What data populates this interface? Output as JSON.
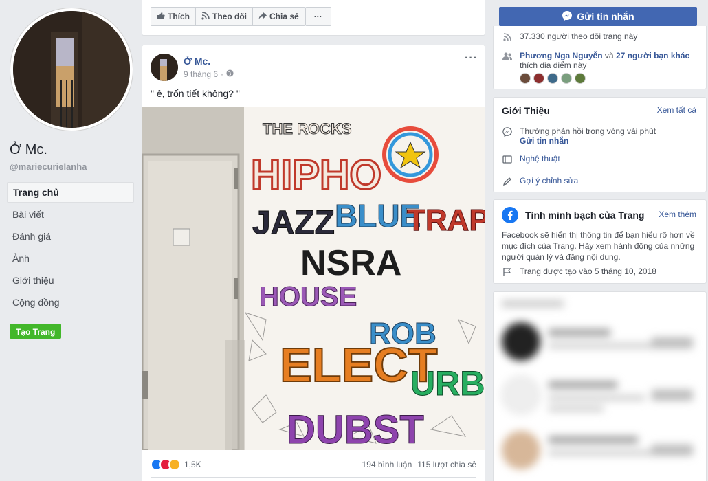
{
  "page": {
    "name": "Ở Mc.",
    "handle": "@mariecurielanha"
  },
  "nav": {
    "items": [
      {
        "label": "Trang chủ"
      },
      {
        "label": "Bài viết"
      },
      {
        "label": "Đánh giá"
      },
      {
        "label": "Ảnh"
      },
      {
        "label": "Giới thiệu"
      },
      {
        "label": "Cộng đồng"
      }
    ],
    "create_label": "Tạo Trang"
  },
  "actions": {
    "like_label": "Thích",
    "follow_label": "Theo dõi",
    "share_label": "Chia sẻ",
    "more_label": "···"
  },
  "post": {
    "author": "Ở Mc.",
    "date": "9 tháng 6",
    "separator": "·",
    "text": "\" ê, trốn tiết không? \"",
    "menu": "···",
    "reactions_count": "1,5K",
    "comments": "194 bình luận",
    "shares": "115 lượt chia sẻ"
  },
  "sidebar": {
    "message_button": "Gửi tin nhắn",
    "followers_text": "37.330 người theo dõi trang này",
    "friend_like": {
      "friend_name": "Phương Nga Nguyễn",
      "conjunction": "và",
      "others": "27 người bạn khác",
      "suffix": "thích địa điểm này"
    },
    "about": {
      "title": "Giới Thiệu",
      "see_all": "Xem tất cả",
      "response_text": "Thường phản hồi trong vòng vài phút",
      "send_message": "Gửi tin nhắn",
      "category": "Nghệ thuật",
      "suggest_edit": "Gợi ý chỉnh sửa"
    },
    "transparency": {
      "title": "Tính minh bạch của Trang",
      "see_more": "Xem thêm",
      "description": "Facebook sẽ hiển thị thông tin để bạn hiểu rõ hơn về mục đích của Trang. Hãy xem hành động của những người quản lý và đăng nội dung.",
      "created": "Trang được tạo vào 5 tháng 10, 2018"
    }
  },
  "colors": {
    "facebook_blue": "#4267b2",
    "link": "#385898",
    "green": "#42b72a",
    "background": "#e9ebee"
  }
}
